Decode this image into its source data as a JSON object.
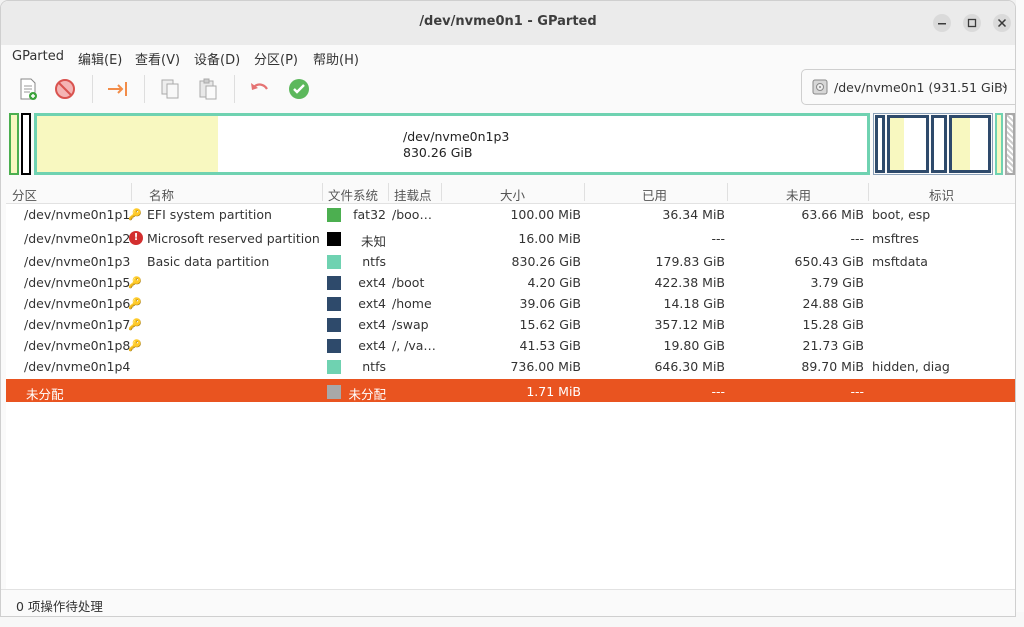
{
  "window": {
    "title": "/dev/nvme0n1 - GParted"
  },
  "menu": [
    "GParted",
    "编辑(E)",
    "查看(V)",
    "设备(D)",
    "分区(P)",
    "帮助(H)"
  ],
  "toolbar": {
    "icons": [
      "new-partition-icon",
      "delete-icon",
      "resize-move-icon",
      "copy-icon",
      "paste-icon",
      "undo-icon",
      "apply-icon"
    ]
  },
  "device": {
    "label": "/dev/nvme0n1 (931.51 GiB)"
  },
  "diskmap": {
    "label_name": "/dev/nvme0n1p3",
    "label_size": "830.26 GiB"
  },
  "columns": [
    "分区",
    "名称",
    "文件系统",
    "挂载点",
    "大小",
    "已用",
    "未用",
    "标识"
  ],
  "rows": [
    {
      "part": "/dev/nvme0n1p1",
      "icon": "key-icon",
      "name": "EFI system partition",
      "color": "#4caf50",
      "fs": "fat32",
      "mount": "/boo…",
      "size": "100.00 MiB",
      "used": "36.34 MiB",
      "unused": "63.66 MiB",
      "flags": "boot, esp"
    },
    {
      "part": "/dev/nvme0n1p2",
      "icon": "warning-icon",
      "name": "Microsoft reserved partition",
      "color": "#000000",
      "fs": "未知",
      "mount": "",
      "size": "16.00 MiB",
      "used": "---",
      "unused": "---",
      "flags": "msftres"
    },
    {
      "part": "/dev/nvme0n1p3",
      "icon": "",
      "name": "Basic data partition",
      "color": "#6fd2b1",
      "fs": "ntfs",
      "mount": "",
      "size": "830.26 GiB",
      "used": "179.83 GiB",
      "unused": "650.43 GiB",
      "flags": "msftdata"
    },
    {
      "part": "/dev/nvme0n1p5",
      "icon": "key-icon",
      "name": "",
      "color": "#2e4a6b",
      "fs": "ext4",
      "mount": "/boot",
      "size": "4.20 GiB",
      "used": "422.38 MiB",
      "unused": "3.79 GiB",
      "flags": ""
    },
    {
      "part": "/dev/nvme0n1p6",
      "icon": "key-icon",
      "name": "",
      "color": "#2e4a6b",
      "fs": "ext4",
      "mount": "/home",
      "size": "39.06 GiB",
      "used": "14.18 GiB",
      "unused": "24.88 GiB",
      "flags": ""
    },
    {
      "part": "/dev/nvme0n1p7",
      "icon": "key-icon",
      "name": "",
      "color": "#2e4a6b",
      "fs": "ext4",
      "mount": "/swap",
      "size": "15.62 GiB",
      "used": "357.12 MiB",
      "unused": "15.28 GiB",
      "flags": ""
    },
    {
      "part": "/dev/nvme0n1p8",
      "icon": "key-icon",
      "name": "",
      "color": "#2e4a6b",
      "fs": "ext4",
      "mount": "/, /va…",
      "size": "41.53 GiB",
      "used": "19.80 GiB",
      "unused": "21.73 GiB",
      "flags": ""
    },
    {
      "part": "/dev/nvme0n1p4",
      "icon": "",
      "name": "",
      "color": "#6fd2b1",
      "fs": "ntfs",
      "mount": "",
      "size": "736.00 MiB",
      "used": "646.30 MiB",
      "unused": "89.70 MiB",
      "flags": "hidden, diag"
    },
    {
      "part": "未分配",
      "icon": "",
      "name": "",
      "color": "#a8a8a8",
      "fs": "未分配",
      "mount": "",
      "size": "1.71 MiB",
      "used": "---",
      "unused": "---",
      "flags": "",
      "selected": true
    }
  ],
  "status": "0 项操作待处理",
  "colors": {
    "selection": "#e95420",
    "ntfs": "#6fd2b1",
    "ext4": "#2e4a6b",
    "fat32": "#4caf50",
    "used": "#f8f8c0"
  }
}
